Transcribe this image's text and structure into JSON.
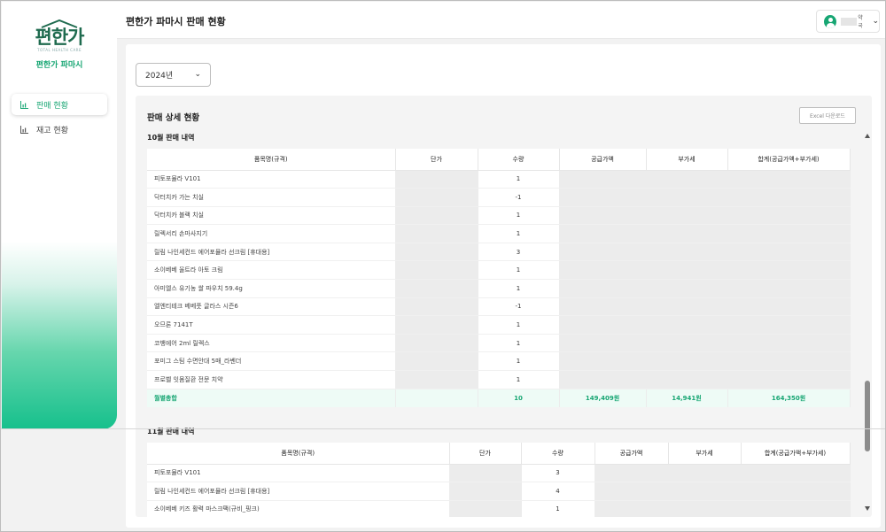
{
  "sidebar": {
    "logo_main": "편한가",
    "logo_sub": "TOTAL HEALTH CARE",
    "logo_name": "편한가 파마시",
    "items": [
      {
        "label": "판매 현황",
        "active": true
      },
      {
        "label": "재고 현황",
        "active": false
      }
    ]
  },
  "header": {
    "title": "편한가 파마시 판매 현황",
    "user_name": "약국"
  },
  "filters": {
    "year": "2024년"
  },
  "panel": {
    "title": "판매 상세 현황",
    "excel_button": "Excel 다운로드"
  },
  "october": {
    "title": "10월 판매 내역",
    "columns": [
      "품목명(규격)",
      "단가",
      "수량",
      "공급가액",
      "부가세",
      "합계(공급가액+부가세)"
    ],
    "rows": [
      {
        "name": "피토포뮬라 V101",
        "qty": "1"
      },
      {
        "name": "닥터치카 가는 치실",
        "qty": "-1"
      },
      {
        "name": "닥터치카 블랙 치실",
        "qty": "1"
      },
      {
        "name": "릴렉서리 손마사지기",
        "qty": "1"
      },
      {
        "name": "릴림 나인세컨드 에어포뮬라 선크림 [휴대용]",
        "qty": "3"
      },
      {
        "name": "소이베베 울트라 아토 크림",
        "qty": "1"
      },
      {
        "name": "아미엘스 유기농 쌀 파우치 59.4g",
        "qty": "1"
      },
      {
        "name": "엘엔티테크 베베풋 글라스 시즌6",
        "qty": "-1"
      },
      {
        "name": "오므론 7141T",
        "qty": "1"
      },
      {
        "name": "코뱅에어 2ml 릴렉스",
        "qty": "1"
      },
      {
        "name": "포미그 스팀 수면안대 5매_라벤더",
        "qty": "1"
      },
      {
        "name": "프로벨 잇몸질환 전문 치약",
        "qty": "1"
      }
    ],
    "total": {
      "label": "월별총합",
      "qty": "10",
      "supply": "149,409원",
      "vat": "14,941원",
      "sum": "164,350원"
    }
  },
  "november": {
    "title": "11월 판매 내역",
    "columns": [
      "품목명(규격)",
      "단가",
      "수량",
      "공급가액",
      "부가세",
      "합계(공급가액+부가세)"
    ],
    "rows": [
      {
        "name": "피토포뮬라 V101",
        "qty": "3"
      },
      {
        "name": "릴림 나인세컨드 에어포뮬라 선크림 [휴대용]",
        "qty": "4"
      },
      {
        "name": "소이베베 키즈 활력 마스크팩(규비_핑크)",
        "qty": "1"
      }
    ]
  },
  "colors": {
    "accent": "#17a673",
    "total_bg": "#eefbf6"
  }
}
